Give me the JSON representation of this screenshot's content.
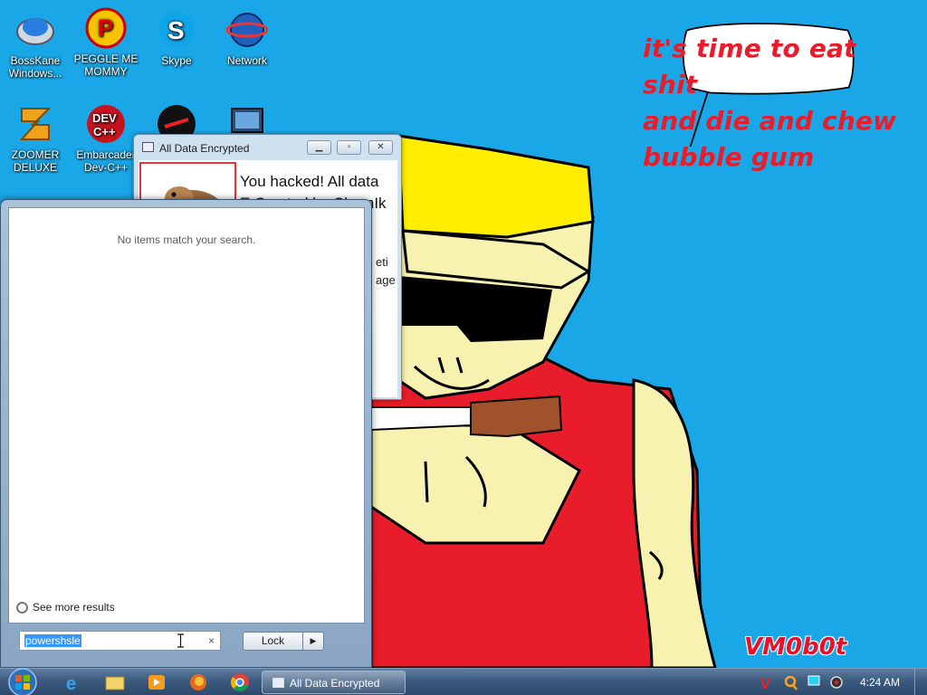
{
  "desktop": {
    "icons": [
      {
        "label": "BossKane Windows..."
      },
      {
        "label": "PEGGLE ME MOMMY"
      },
      {
        "label": "Skype"
      },
      {
        "label": "Network"
      },
      {
        "label": "ZOOMER DELUXE"
      },
      {
        "label": "Embarcader Dev-C++"
      },
      {
        "label": ""
      },
      {
        "label": ""
      }
    ],
    "speech_bubble": {
      "line1": "it's time to eat shit",
      "line2": "and die and chew",
      "line3": "bubble gum"
    },
    "watermark": "VM0b0t"
  },
  "encrypted_window": {
    "title": "All Data Encrypted",
    "message_line1": "You hacked! All data",
    "message_line2": "E  Crypted by ChemIk",
    "fragment1": "eti",
    "fragment2": "age",
    "minimize_icon": "minimize-icon",
    "maximize_icon": "maximize-icon",
    "close_icon": "close-icon"
  },
  "start_menu": {
    "no_items": "No items match your search.",
    "see_more": "See more results",
    "search_value": "powershsle",
    "clear_glyph": "×",
    "lock_label": "Lock",
    "lock_arrow": "▶"
  },
  "taskbar": {
    "task_label": "All Data Encrypted",
    "clock": "4:24 AM",
    "pinned": [
      "internet-explorer-icon",
      "folder-icon",
      "media-player-icon",
      "firefox-icon",
      "chrome-icon"
    ]
  },
  "colors": {
    "wallpaper": "#1aa7e8",
    "speech_text": "#e81c2a",
    "accent_red": "#e8323a"
  }
}
